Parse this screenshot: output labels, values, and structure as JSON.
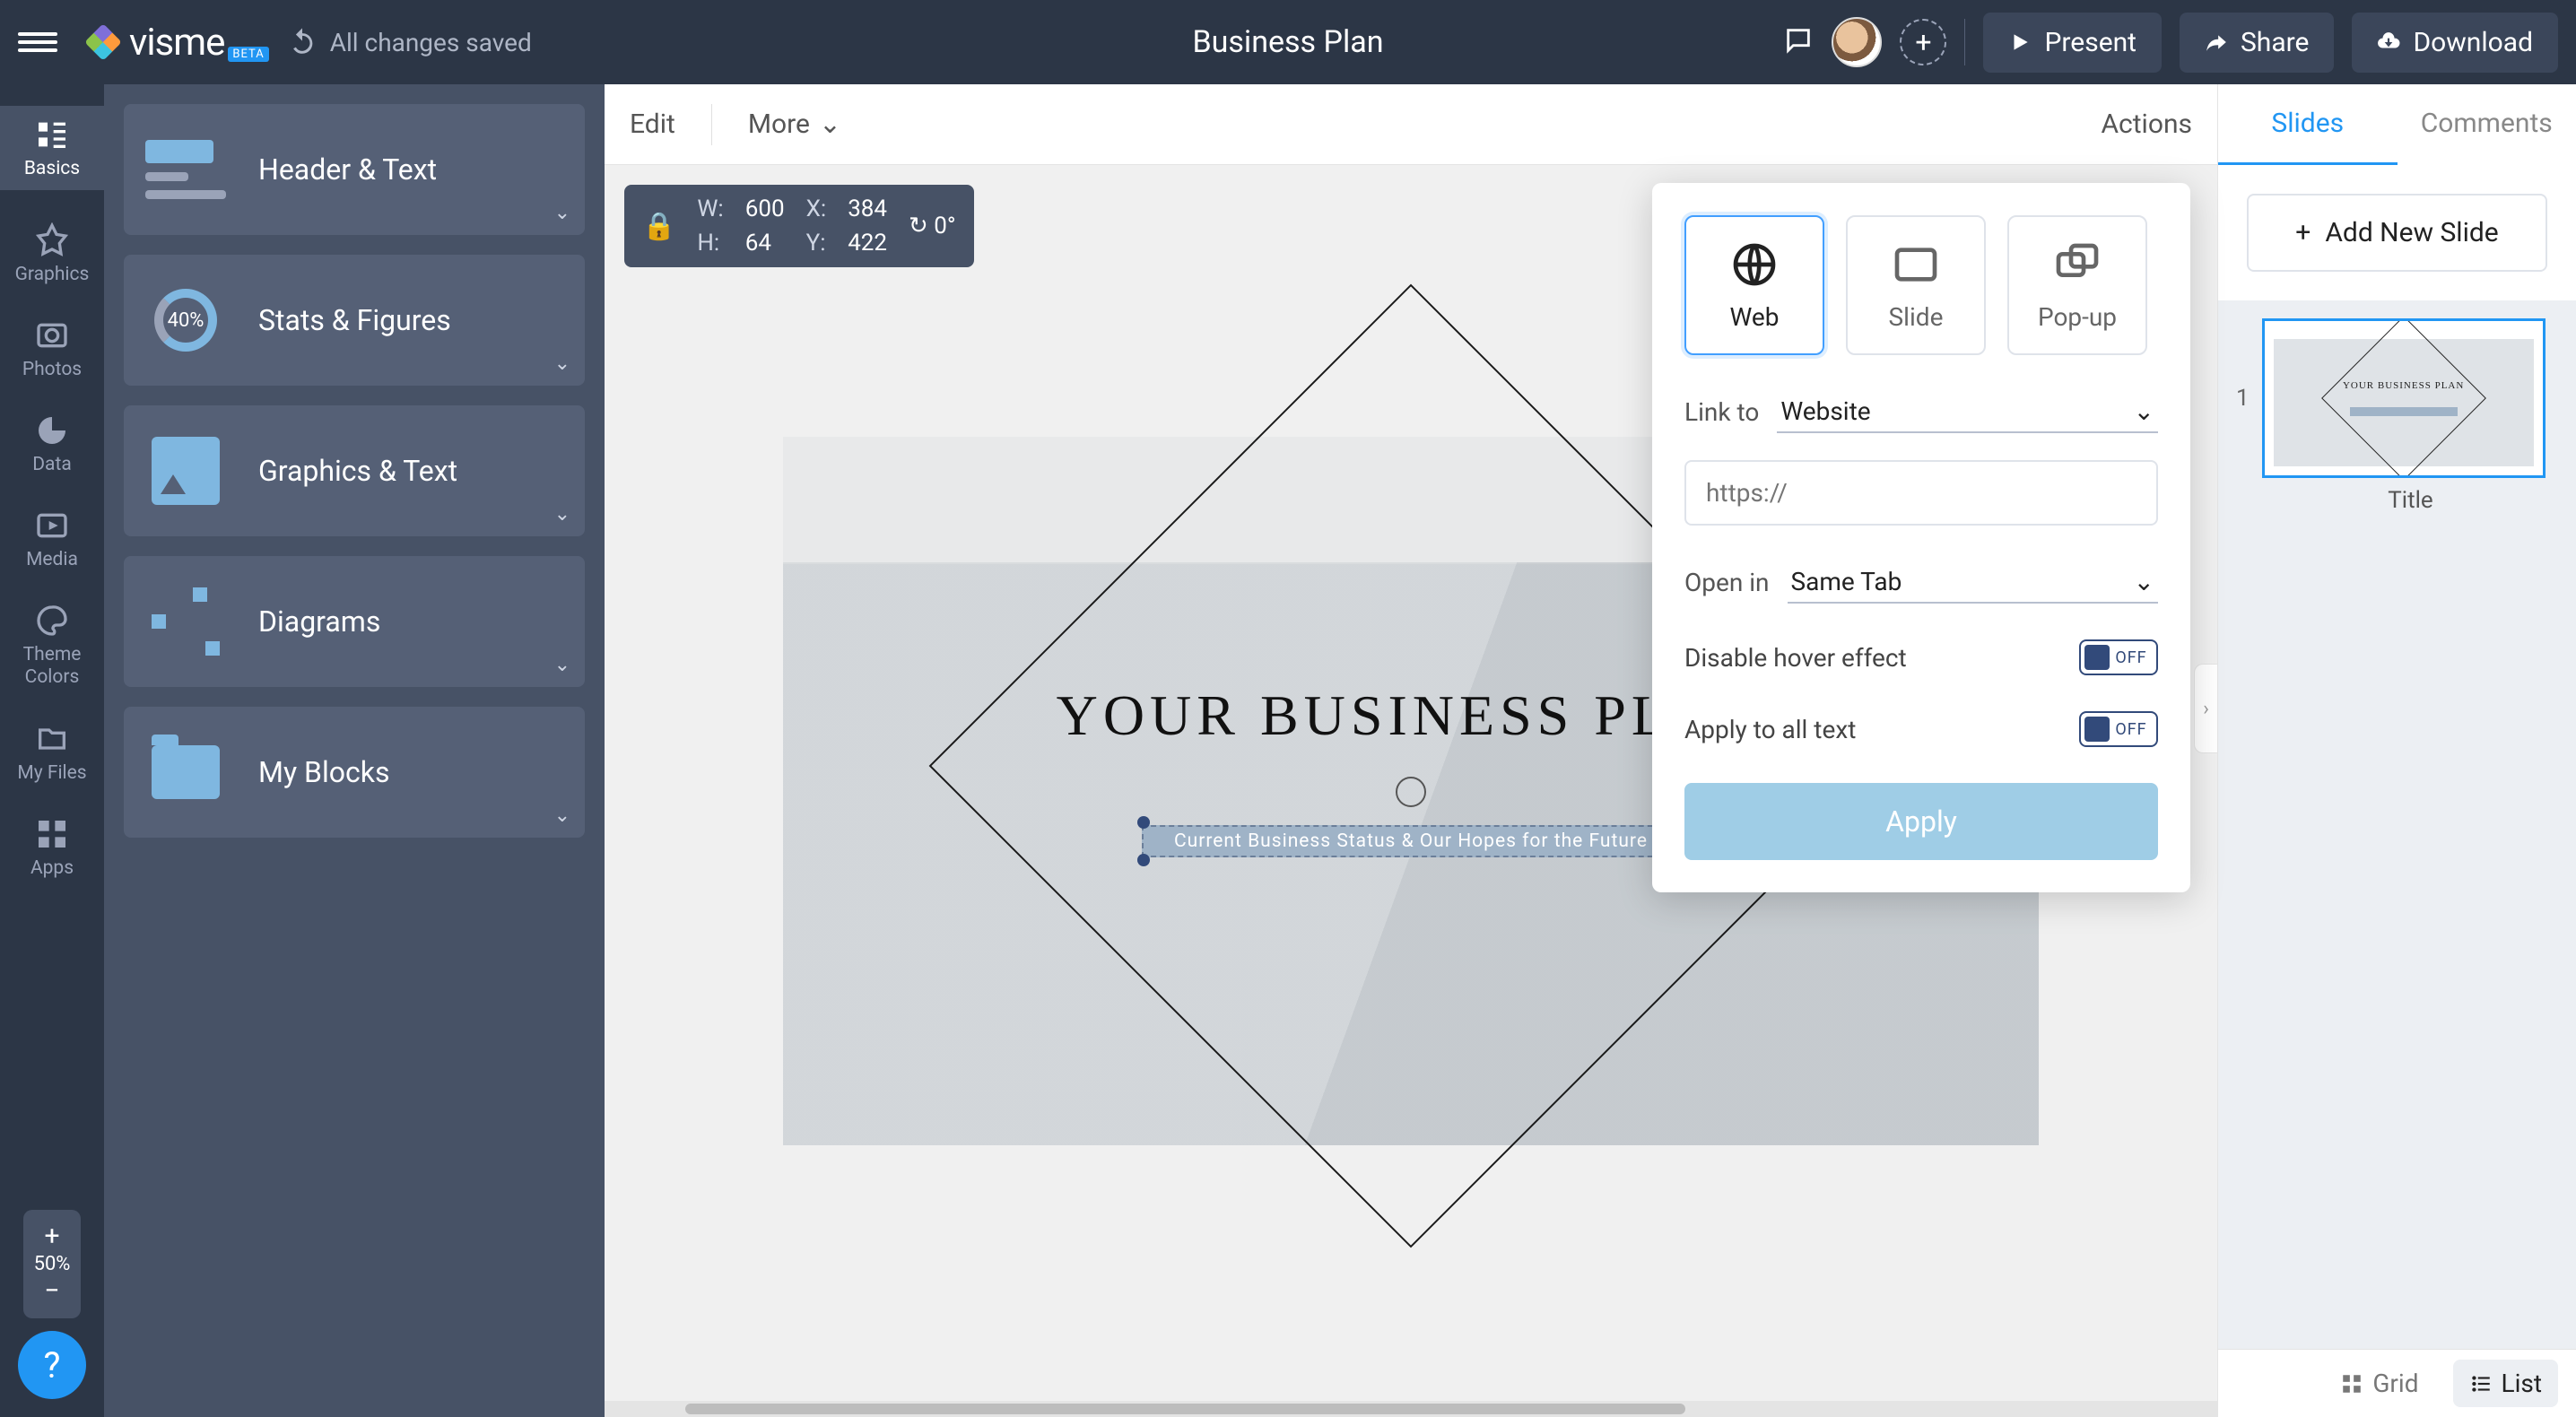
{
  "topbar": {
    "save_status": "All changes saved",
    "doc_title": "Business Plan",
    "present": "Present",
    "share": "Share",
    "download": "Download",
    "logo_text": "visme",
    "logo_beta": "BETA"
  },
  "rail": {
    "items": [
      {
        "label": "Basics"
      },
      {
        "label": "Graphics"
      },
      {
        "label": "Photos"
      },
      {
        "label": "Data"
      },
      {
        "label": "Media"
      },
      {
        "label": "Theme Colors"
      },
      {
        "label": "My Files"
      },
      {
        "label": "Apps"
      }
    ],
    "zoom": "50%"
  },
  "blocks": {
    "items": [
      {
        "label": "Header & Text"
      },
      {
        "label": "Stats & Figures",
        "badge": "40%"
      },
      {
        "label": "Graphics & Text"
      },
      {
        "label": "Diagrams"
      },
      {
        "label": "My Blocks"
      }
    ]
  },
  "context_bar": {
    "edit": "Edit",
    "more": "More",
    "actions": "Actions"
  },
  "dimensions": {
    "w_label": "W:",
    "w": "600",
    "h_label": "H:",
    "h": "64",
    "x_label": "X:",
    "x": "384",
    "y_label": "Y:",
    "y": "422",
    "rotation": "0°"
  },
  "canvas": {
    "headline": "YOUR BUSINESS PLAN",
    "subtitle": "Current Business Status & Our Hopes for the Future"
  },
  "actions_panel": {
    "modes": {
      "web": "Web",
      "slide": "Slide",
      "popup": "Pop-up"
    },
    "link_to_label": "Link to",
    "link_to_value": "Website",
    "url_placeholder": "https://",
    "open_in_label": "Open in",
    "open_in_value": "Same Tab",
    "disable_hover": "Disable hover effect",
    "apply_all": "Apply to all text",
    "toggle_off": "OFF",
    "apply_btn": "Apply"
  },
  "right_panel": {
    "tab_slides": "Slides",
    "tab_comments": "Comments",
    "add_slide": "Add New Slide",
    "slide1_num": "1",
    "slide1_label": "Title",
    "thumb_headline": "YOUR BUSINESS PLAN",
    "grid": "Grid",
    "list": "List"
  }
}
